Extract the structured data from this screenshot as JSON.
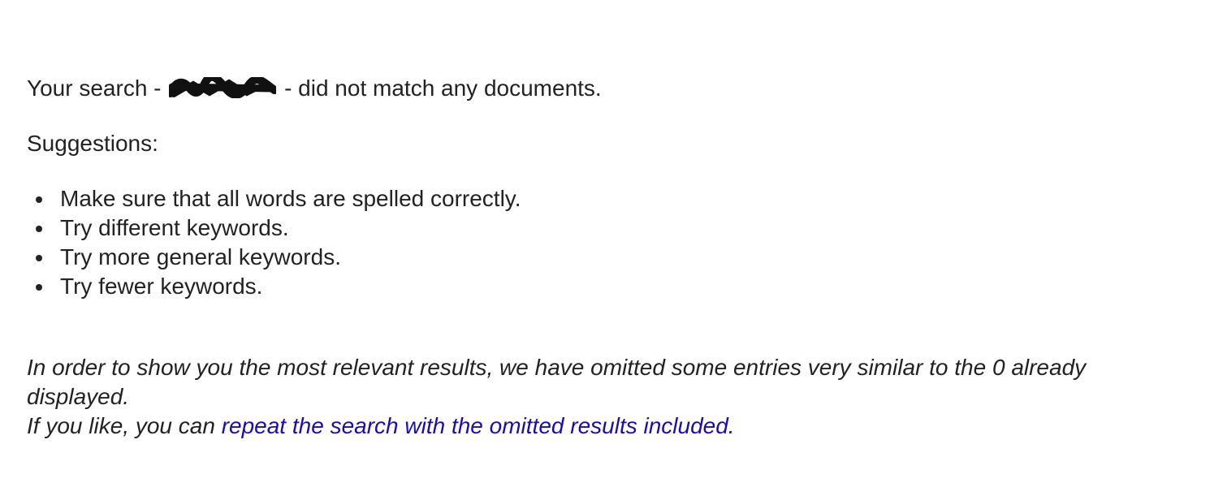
{
  "no_match": {
    "prefix": "Your search -",
    "suffix": "- did not match any documents."
  },
  "suggestions": {
    "label": "Suggestions:",
    "items": [
      "Make sure that all words are spelled correctly.",
      "Try different keywords.",
      "Try more general keywords.",
      "Try fewer keywords."
    ]
  },
  "omitted": {
    "line1": "In order to show you the most relevant results, we have omitted some entries very similar to the 0 already displayed.",
    "line2_prefix": "If you like, you can",
    "link_text": "repeat the search with the omitted results included.",
    "link_color": "#1a0dab"
  },
  "colors": {
    "text": "#222222",
    "background": "#ffffff"
  }
}
